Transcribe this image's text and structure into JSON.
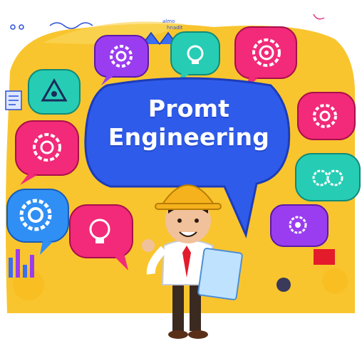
{
  "headline": {
    "line1": "Promt",
    "line2": "Engineering"
  },
  "scribble_text": {
    "line1": "ǝlmo",
    "line2": "hnadlt"
  },
  "colors": {
    "background": "#f9c52e",
    "main_bubble": "#2f5bea",
    "purple_bubble": "#9a3df0",
    "teal_bubble": "#26cdb4",
    "pink_bubble": "#f22a79",
    "blue_bubble": "#2f8ff5",
    "hard_hat": "#f6b21d",
    "shirt_tie": "#e41b2b"
  },
  "icons": [
    "gear-icon",
    "lightbulb-icon",
    "warning-triangle-icon",
    "target-gear-icon",
    "cogs-icon",
    "lightbulb-gear-icon",
    "document-icon"
  ]
}
